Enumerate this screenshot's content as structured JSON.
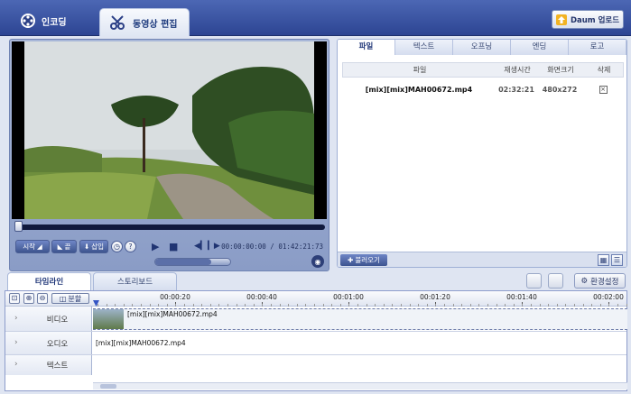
{
  "header": {
    "tab_encode": "인코딩",
    "tab_edit": "동영상 편집",
    "daum_upload": "Daum 업로드"
  },
  "player": {
    "btn_start": "시작",
    "btn_end": "끝",
    "btn_insert": "삽입",
    "btn_help": "?",
    "time_current": "00:00:00:00",
    "time_total": "01:42:21:73",
    "seek_progress": 0.0,
    "volume": 0.75
  },
  "file_panel": {
    "tabs": [
      "파일",
      "텍스트",
      "오프닝",
      "엔딩",
      "로고"
    ],
    "active_tab": "파일",
    "columns": [
      "파일",
      "재생시간",
      "화면크기",
      "삭제"
    ],
    "rows": [
      {
        "name": "[mix][mix]MAH00672.mp4",
        "duration": "02:32:21",
        "size": "480x272",
        "delete": "×"
      }
    ],
    "load_button": "불러오기"
  },
  "timeline": {
    "tabs": [
      "타임라인",
      "스토리보드"
    ],
    "active_tab": "타임라인",
    "settings_button": "환경설정",
    "split_button": "분할",
    "ruler_labels": [
      "00:00:20",
      "00:00:40",
      "00:01:00",
      "00:01:20",
      "00:01:40",
      "00:02:00"
    ],
    "tracks": [
      {
        "name": "비디오",
        "clip": "[mix][mix]MAH00672.mp4"
      },
      {
        "name": "오디오",
        "clip": "[mix][mix]MAH00672.mp4"
      },
      {
        "name": "텍스트",
        "clip": ""
      }
    ]
  },
  "colors": {
    "header_bg": "#2d4593",
    "frame_bg": "#dfe5f2",
    "accent": "#3e558f"
  }
}
